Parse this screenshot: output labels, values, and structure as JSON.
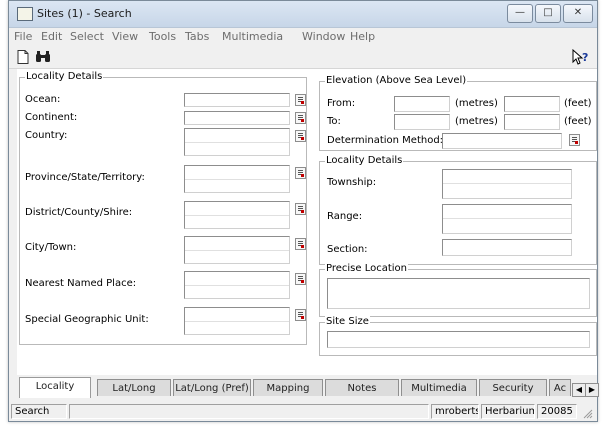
{
  "window": {
    "title": "Sites (1) - Search"
  },
  "menu": [
    "File",
    "Edit",
    "Select",
    "View",
    "Tools",
    "Tabs",
    "Multimedia",
    "Window",
    "Help"
  ],
  "toolbar": {
    "new_icon": "new-document-icon",
    "search_icon": "binoculars-icon",
    "help_icon": "context-help-icon"
  },
  "locality": {
    "title": "Locality Details",
    "ocean": "Ocean:",
    "continent": "Continent:",
    "country": "Country:",
    "province": "Province/State/Territory:",
    "district": "District/County/Shire:",
    "city": "City/Town:",
    "nearest": "Nearest Named Place:",
    "special": "Special Geographic Unit:"
  },
  "elevation": {
    "title": "Elevation (Above Sea Level)",
    "from": "From:",
    "to": "To:",
    "metres": "(metres)",
    "feet": "(feet)",
    "method": "Determination Method:"
  },
  "locality2": {
    "title": "Locality Details",
    "township": "Township:",
    "range": "Range:",
    "section": "Section:"
  },
  "precise": {
    "title": "Precise Location"
  },
  "sitesize": {
    "title": "Site Size"
  },
  "tabs": [
    "Locality",
    "Lat/Long",
    "Lat/Long (Pref)",
    "Mapping",
    "Notes",
    "Multimedia",
    "Security",
    "Ac"
  ],
  "status": {
    "mode": "Search",
    "user": "mroberts",
    "department": "Herbarium",
    "count": "20085"
  }
}
